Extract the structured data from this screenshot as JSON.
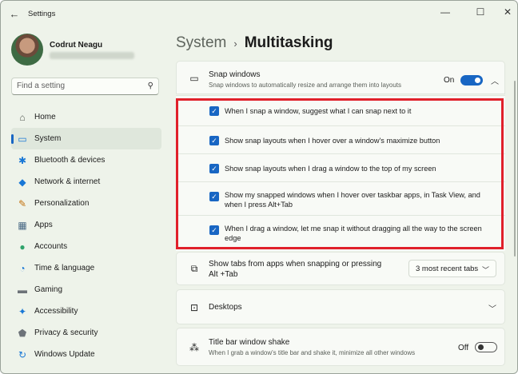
{
  "window": {
    "title": "Settings",
    "back_icon": "back-arrow-icon",
    "min_glyph": "—",
    "max_glyph": "☐",
    "close_glyph": "✕"
  },
  "profile": {
    "name": "Codrut Neagu"
  },
  "search": {
    "placeholder": "Find a setting",
    "icon": "search-icon"
  },
  "nav": [
    {
      "label": "Home",
      "icon": "home-icon",
      "glyph": "⌂",
      "color": "#555b54"
    },
    {
      "label": "System",
      "icon": "monitor-icon",
      "glyph": "▭",
      "color": "#1877d6",
      "active": true
    },
    {
      "label": "Bluetooth & devices",
      "icon": "bluetooth-icon",
      "glyph": "✱",
      "color": "#1877d6"
    },
    {
      "label": "Network & internet",
      "icon": "wifi-icon",
      "glyph": "◆",
      "color": "#1877d6"
    },
    {
      "label": "Personalization",
      "icon": "brush-icon",
      "glyph": "✎",
      "color": "#c2700c"
    },
    {
      "label": "Apps",
      "icon": "apps-icon",
      "glyph": "▦",
      "color": "#4a6a85"
    },
    {
      "label": "Accounts",
      "icon": "accounts-icon",
      "glyph": "●",
      "color": "#2fa36b"
    },
    {
      "label": "Time & language",
      "icon": "globe-clock-icon",
      "glyph": "◔",
      "color": "#1877d6"
    },
    {
      "label": "Gaming",
      "icon": "gamepad-icon",
      "glyph": "▬",
      "color": "#6d7379"
    },
    {
      "label": "Accessibility",
      "icon": "accessibility-icon",
      "glyph": "✦",
      "color": "#1877d6"
    },
    {
      "label": "Privacy & security",
      "icon": "shield-icon",
      "glyph": "⬟",
      "color": "#6d7379"
    },
    {
      "label": "Windows Update",
      "icon": "update-icon",
      "glyph": "↻",
      "color": "#1877d6"
    }
  ],
  "breadcrumb": {
    "parent": "System",
    "separator": "›",
    "current": "Multitasking"
  },
  "snap": {
    "title": "Snap windows",
    "description": "Snap windows to automatically resize and arrange them into layouts",
    "toggle_label": "On",
    "toggle_state": true,
    "icon": "snap-window-icon"
  },
  "snap_options": [
    {
      "text": "When I snap a window, suggest what I can snap next to it",
      "checked": true
    },
    {
      "text": "Show snap layouts when I hover over a window's maximize button",
      "checked": true
    },
    {
      "text": "Show snap layouts when I drag a window to the top of my screen",
      "checked": true
    },
    {
      "text": "Show my snapped windows when I hover over taskbar apps, in Task View, and when I press Alt+Tab",
      "checked": true
    },
    {
      "text": "When I drag a window, let me snap it without dragging all the way to the screen edge",
      "checked": true
    }
  ],
  "tabs_setting": {
    "title": "Show tabs from apps when snapping or pressing Alt +Tab",
    "value": "3 most recent tabs",
    "icon": "tabs-icon"
  },
  "desktops": {
    "title": "Desktops",
    "icon": "desktops-icon"
  },
  "shake": {
    "title": "Title bar window shake",
    "description": "When I grab a window's title bar and shake it, minimize all other windows",
    "toggle_label": "Off",
    "toggle_state": false,
    "icon": "shake-icon"
  },
  "colors": {
    "accent": "#1866c3",
    "highlight": "#e0202a",
    "background": "#eef3ea"
  }
}
